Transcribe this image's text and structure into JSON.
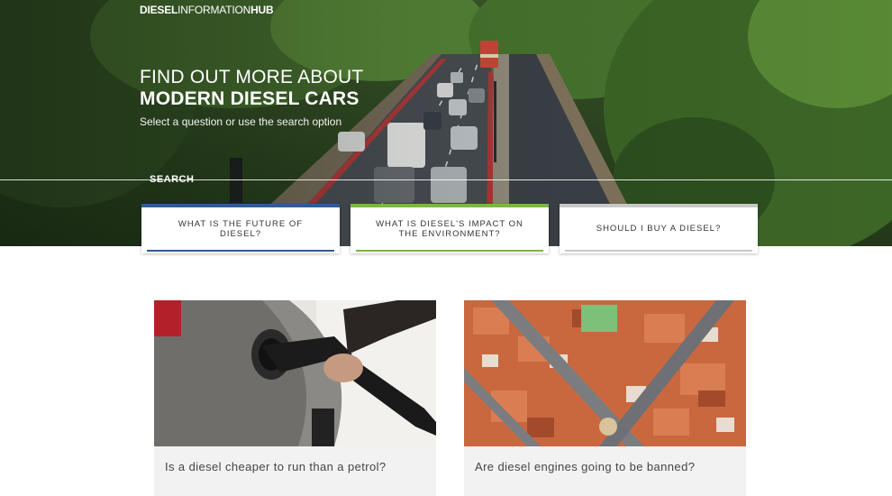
{
  "logo": {
    "part1": "DIESEL",
    "part2": "INFORMATION",
    "part3": "HUB"
  },
  "hero": {
    "headline_line1": "FIND OUT MORE ABOUT",
    "headline_line2": "MODERN DIESEL CARS",
    "subtitle": "Select a question or use the search option",
    "search_label": "SEARCH"
  },
  "questions": [
    {
      "label": "WHAT IS THE FUTURE OF DIESEL?",
      "color": "#2f5d93"
    },
    {
      "label": "WHAT IS DIESEL'S IMPACT ON THE ENVIRONMENT?",
      "color": "#7ab648"
    },
    {
      "label": "SHOULD I BUY A DIESEL?",
      "color": "#c8c8c8"
    }
  ],
  "articles": [
    {
      "title": "Is a diesel cheaper to run than a petrol?",
      "image": "fuel-pump-photo"
    },
    {
      "title": "Are diesel engines going to be banned?",
      "image": "aerial-city-photo"
    }
  ]
}
